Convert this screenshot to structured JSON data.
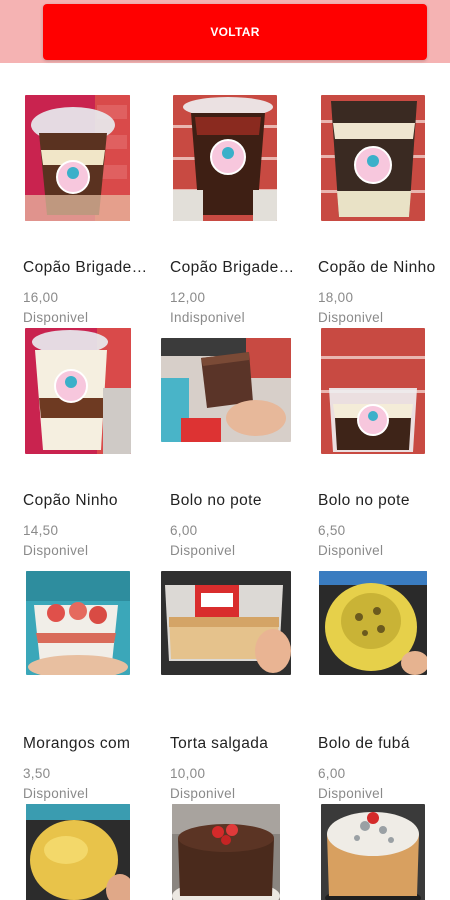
{
  "header": {
    "back_label": "VOLTAR"
  },
  "colors": {
    "accent": "#ff0000",
    "header_bg": "#f5b3b3"
  },
  "products": [
    {
      "name": "Copão Brigadeiro",
      "price": "16,00",
      "status": "Disponivel",
      "image": "cup-brigadeiro-lid"
    },
    {
      "name": "Copão Brigadeiro",
      "price": "12,00",
      "status": "Indisponivel",
      "image": "cup-brigadeiro-open"
    },
    {
      "name": "Copão de Ninho",
      "price": "18,00",
      "status": "Disponivel",
      "image": "cup-ninho-chocolate"
    },
    {
      "name": "Copão Ninho",
      "price": "14,50",
      "status": "Disponivel",
      "image": "cup-ninho-lid"
    },
    {
      "name": "Bolo no pote",
      "price": "6,00",
      "status": "Disponivel",
      "image": "cake-slice-hand"
    },
    {
      "name": "Bolo no pote",
      "price": "6,50",
      "status": "Disponivel",
      "image": "cake-pot-wall"
    },
    {
      "name": "Morangos com",
      "price": "3,50",
      "status": "Disponivel",
      "image": "strawberry-cream-cup"
    },
    {
      "name": "Torta salgada",
      "price": "10,00",
      "status": "Disponivel",
      "image": "savory-pie-box"
    },
    {
      "name": "Bolo de fubá",
      "price": "6,00",
      "status": "Disponivel",
      "image": "corn-cake-round"
    },
    {
      "name": "",
      "price": "",
      "status": "",
      "image": "corn-cake-small"
    },
    {
      "name": "",
      "price": "",
      "status": "",
      "image": "chocolate-strawberry-cake"
    },
    {
      "name": "",
      "price": "",
      "status": "",
      "image": "coconut-cake"
    }
  ]
}
